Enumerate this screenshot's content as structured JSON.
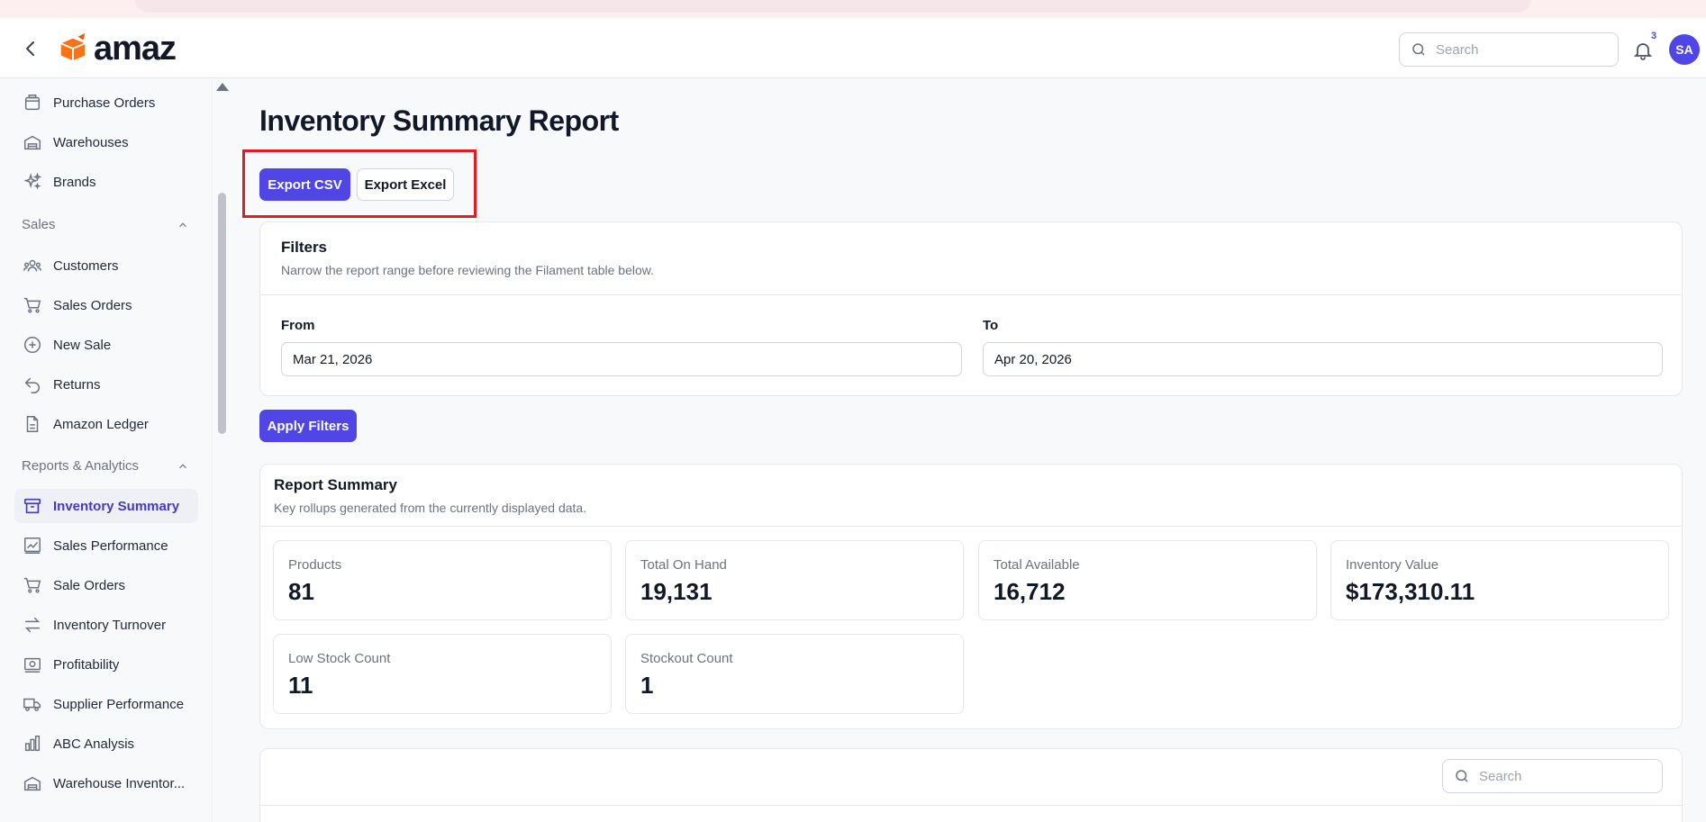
{
  "header": {
    "logo_text": "amaz",
    "search_placeholder": "Search",
    "notification_count": "3",
    "avatar_initials": "SA"
  },
  "sidebar": {
    "items_top": [
      {
        "label": "Purchase Orders",
        "icon": "clipboard-icon"
      },
      {
        "label": "Warehouses",
        "icon": "warehouse-icon"
      },
      {
        "label": "Brands",
        "icon": "sparkles-icon"
      }
    ],
    "groups": {
      "sales": {
        "label": "Sales",
        "items": [
          {
            "label": "Customers",
            "icon": "users-icon"
          },
          {
            "label": "Sales Orders",
            "icon": "cart-icon"
          },
          {
            "label": "New Sale",
            "icon": "plus-circle-icon"
          },
          {
            "label": "Returns",
            "icon": "return-arrow-icon"
          },
          {
            "label": "Amazon Ledger",
            "icon": "document-icon"
          }
        ]
      },
      "reports": {
        "label": "Reports & Analytics",
        "items": [
          {
            "label": "Inventory Summary",
            "icon": "archive-box-icon",
            "active": true
          },
          {
            "label": "Sales Performance",
            "icon": "chart-line-icon"
          },
          {
            "label": "Sale Orders",
            "icon": "cart-icon"
          },
          {
            "label": "Inventory Turnover",
            "icon": "arrows-exchange-icon"
          },
          {
            "label": "Profitability",
            "icon": "cash-icon"
          },
          {
            "label": "Supplier Performance",
            "icon": "truck-icon"
          },
          {
            "label": "ABC Analysis",
            "icon": "bar-chart-icon"
          },
          {
            "label": "Warehouse Inventor...",
            "icon": "warehouse-icon"
          }
        ]
      }
    }
  },
  "main": {
    "title": "Inventory Summary Report",
    "export_csv_label": "Export CSV",
    "export_excel_label": "Export Excel",
    "filters": {
      "title": "Filters",
      "description": "Narrow the report range before reviewing the Filament table below.",
      "from_label": "From",
      "from_value": "Mar 21, 2026",
      "to_label": "To",
      "to_value": "Apr 20, 2026"
    },
    "apply_label": "Apply Filters",
    "summary": {
      "title": "Report Summary",
      "description": "Key rollups generated from the currently displayed data.",
      "stats": [
        {
          "label": "Products",
          "value": "81"
        },
        {
          "label": "Total On Hand",
          "value": "19,131"
        },
        {
          "label": "Total Available",
          "value": "16,712"
        },
        {
          "label": "Inventory Value",
          "value": "$173,310.11"
        },
        {
          "label": "Low Stock Count",
          "value": "11"
        },
        {
          "label": "Stockout Count",
          "value": "1"
        }
      ]
    },
    "table_search_placeholder": "Search"
  },
  "colors": {
    "accent": "#4f46e5",
    "highlight": "#e11d23",
    "logo_orange": "#f97316"
  }
}
